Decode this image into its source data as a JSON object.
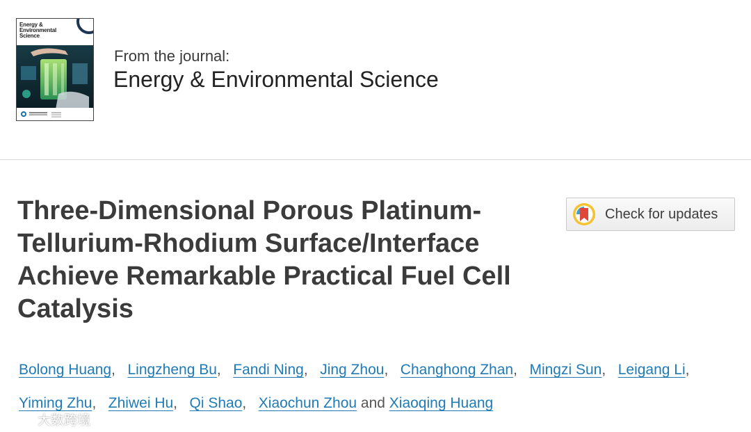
{
  "journal": {
    "cover_title": "Energy & Environmental Science",
    "from_label": "From the journal:",
    "name": "Energy & Environmental Science"
  },
  "article": {
    "title": "Three-Dimensional Porous Platinum-Tellurium-Rhodium Surface/Interface Achieve Remarkable Practical Fuel Cell Catalysis"
  },
  "check_updates": {
    "label": "Check for updates",
    "icon": "crossmark-icon"
  },
  "authors": {
    "list": [
      "Bolong Huang",
      "Lingzheng Bu",
      "Fandi Ning",
      "Jing Zhou",
      "Changhong Zhan",
      "Mingzi Sun",
      "Leigang Li",
      "Yiming Zhu",
      "Zhiwei Hu",
      "Qi Shao",
      "Xiaochun Zhou",
      "Xiaoqing Huang"
    ],
    "separator": ",",
    "conjunction": "and"
  },
  "watermark": {
    "text": "大数跨境"
  },
  "colors": {
    "link": "#1f7bb6",
    "title": "#3b3b3b",
    "divider": "#d6d6d6"
  }
}
